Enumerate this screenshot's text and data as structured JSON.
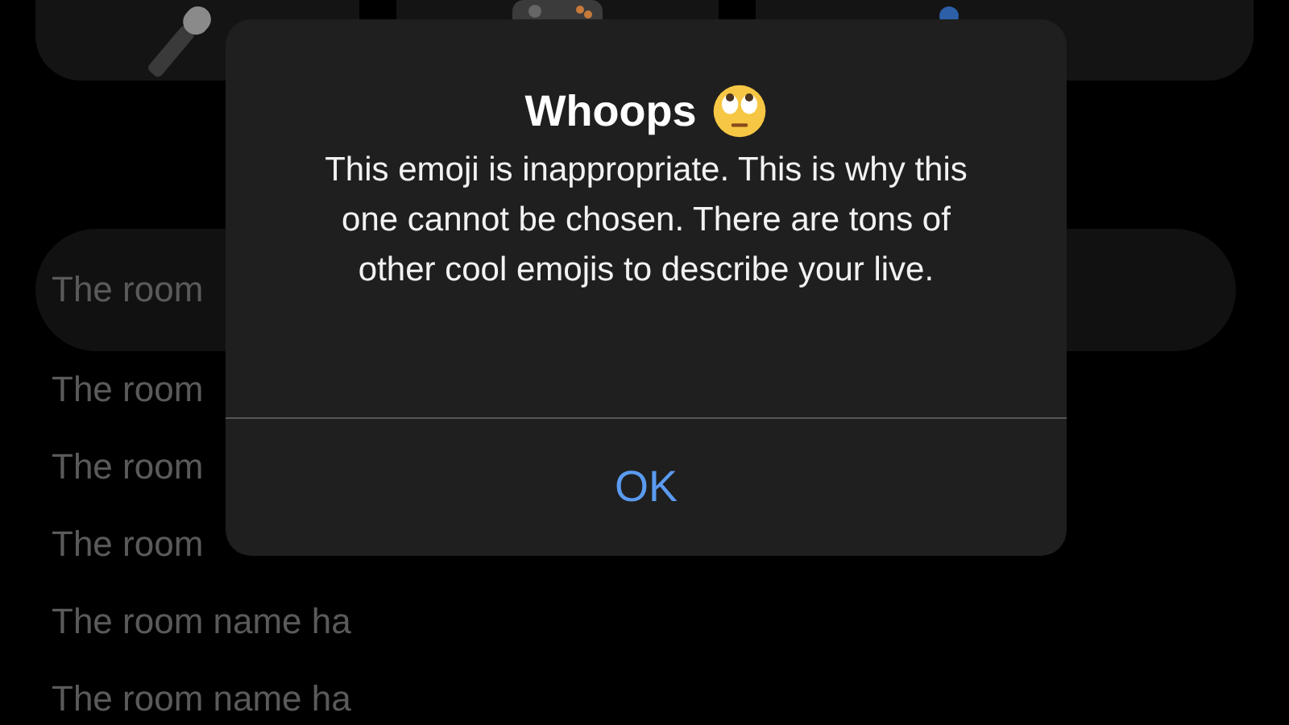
{
  "field": {
    "value": "The room"
  },
  "rows": [
    {
      "text": "The room"
    },
    {
      "text": "The room"
    },
    {
      "text": "The room"
    },
    {
      "text": "The room name ha"
    },
    {
      "text": "The room name ha"
    }
  ],
  "alert": {
    "title": "Whoops",
    "message": "This emoji is inappropriate. This is why this one cannot be chosen. There are tons of other cool emojis to describe your live.",
    "button": "OK"
  }
}
